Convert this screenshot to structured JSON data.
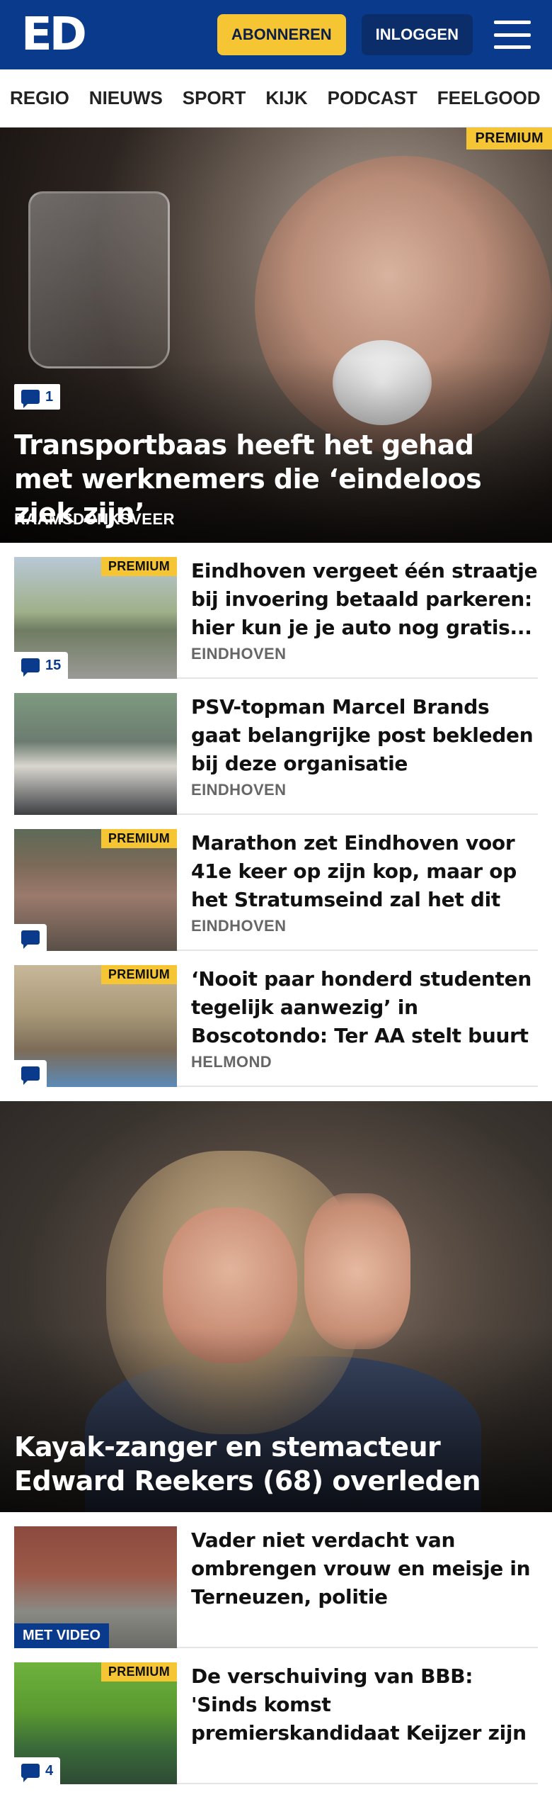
{
  "header": {
    "logo": "ED",
    "subscribe_label": "ABONNEREN",
    "login_label": "INLOGGEN",
    "brand_color": "#0a3a8c",
    "accent_color": "#f6c533"
  },
  "nav": {
    "items": [
      "REGIO",
      "NIEUWS",
      "SPORT",
      "KIJK",
      "PODCAST",
      "FEELGOOD"
    ]
  },
  "hero1": {
    "premium": "PREMIUM",
    "comments": "1",
    "title": "Transportbaas heeft het gehad met werknemers die ‘eindeloos ziek zijn’",
    "location": "RAAMSDONKSVEER"
  },
  "articles1": [
    {
      "premium": "PREMIUM",
      "comments": "15",
      "title": "Eindhoven vergeet één straatje bij invoering betaald parkeren: hier kun je je auto nog gratis...",
      "location": "EINDHOVEN"
    },
    {
      "premium": "",
      "comments": "",
      "title": "PSV-topman Marcel Brands gaat belangrijke post bekleden bij deze organisatie",
      "location": "EINDHOVEN"
    },
    {
      "premium": "PREMIUM",
      "comments": "",
      "title": "Marathon zet Eindhoven voor 41e keer op zijn kop, maar op het Stratumseind zal het dit jaar wa...",
      "location": "EINDHOVEN"
    },
    {
      "premium": "PREMIUM",
      "comments": "",
      "title": "‘Nooit paar honderd studenten tegelijk aanwezig’ in Boscotondo: Ter AA stelt buurt gerust",
      "location": "HELMOND"
    }
  ],
  "hero2": {
    "title": "Kayak-zanger en stemacteur Edward Reekers (68) overleden"
  },
  "articles2": [
    {
      "video": "MET VIDEO",
      "title": "Vader niet verdacht van ombrengen vrouw en meisje in Terneuzen, politie onderzoekt..."
    },
    {
      "premium": "PREMIUM",
      "comments": "4",
      "title": "De verschuiving van BBB: 'Sinds komst premierskandidaat Keijzer zijn we steeds harder geworden..."
    }
  ]
}
